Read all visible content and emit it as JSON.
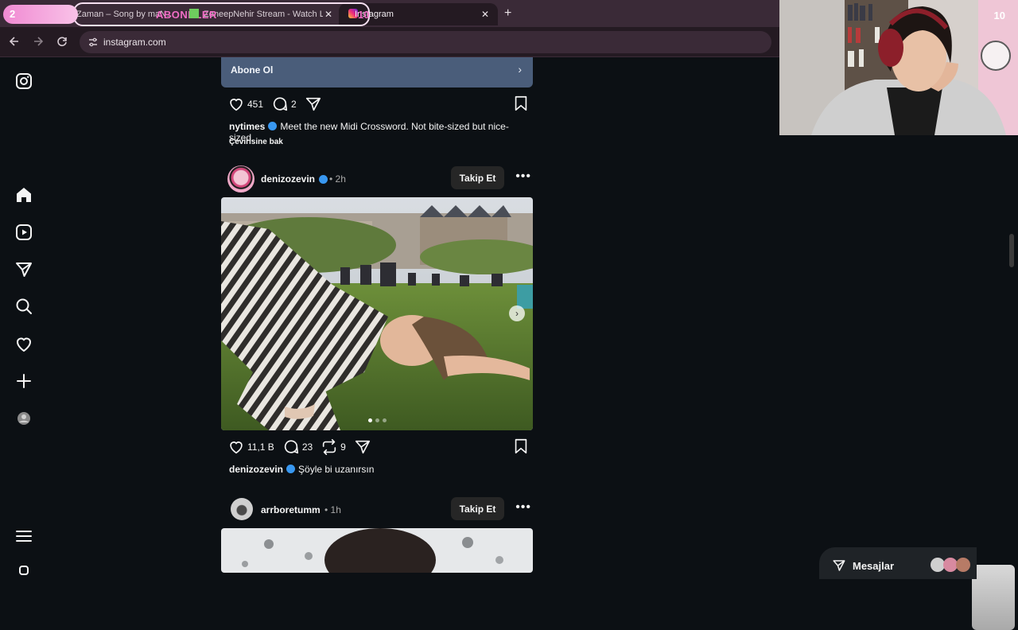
{
  "browser": {
    "tabs": [
      {
        "title": "Zaman – Song by maN…"
      },
      {
        "title": "ZeneepNehir Stream - Watch L…"
      },
      {
        "title": "Instagram",
        "active": true
      }
    ],
    "url": "instagram.com",
    "overlay": {
      "count": "2",
      "label": "ABONELER",
      "count2": "10"
    }
  },
  "feed": {
    "banner": {
      "label": "Abone Ol"
    },
    "post1": {
      "likes": "451",
      "comments": "2",
      "caption_user": "nytimes",
      "caption_text": "Meet the new Midi Crossword. Not bite-sized but nice-sized.",
      "see_translation": "Çevirisine bak"
    },
    "post2": {
      "user": "denizozevin",
      "time": "2h",
      "follow": "Takip Et",
      "likes": "11,1 B",
      "comments": "23",
      "reposts": "9",
      "caption_user": "denizozevin",
      "caption_text": "Şöyle bi uzanırsın"
    },
    "post3": {
      "user": "arrboretumm",
      "time": "1h",
      "follow": "Takip Et"
    }
  },
  "messages": {
    "label": "Mesajlar"
  },
  "webcam": {
    "count": "10"
  },
  "colors": {
    "accent": "#3897f0",
    "bg": "#0c1014",
    "banner": "#4a5d7a"
  }
}
